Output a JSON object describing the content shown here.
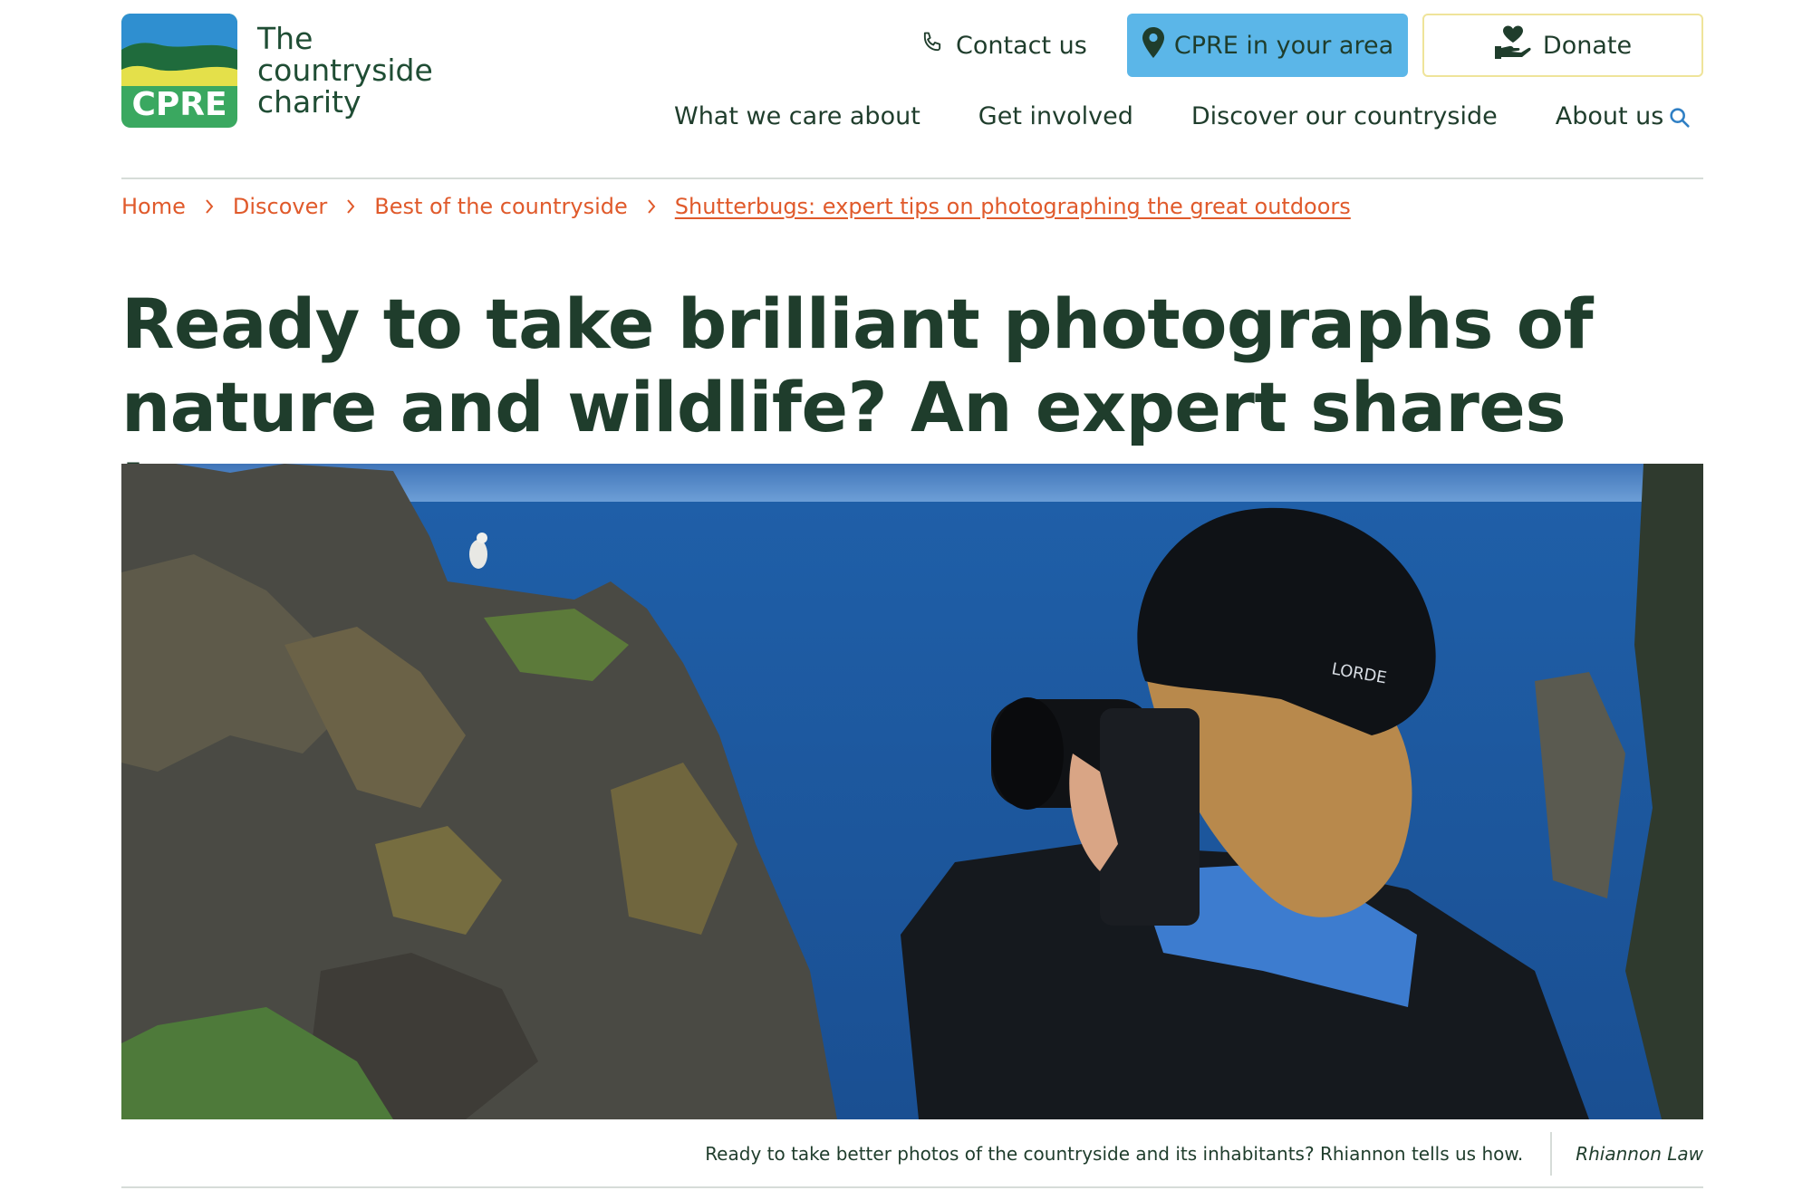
{
  "brand": {
    "badge_text": "CPRE",
    "line1": "The",
    "line2": "countryside",
    "line3": "charity"
  },
  "utility": {
    "contact_label": "Contact us",
    "area_label": "CPRE in your area",
    "donate_label": "Donate"
  },
  "nav": {
    "items": [
      {
        "label": "What we care about"
      },
      {
        "label": "Get involved"
      },
      {
        "label": "Discover our countryside"
      },
      {
        "label": "About us"
      }
    ]
  },
  "breadcrumb": {
    "items": [
      {
        "label": "Home"
      },
      {
        "label": "Discover"
      },
      {
        "label": "Best of the countryside"
      }
    ],
    "current": "Shutterbugs: expert tips on photographing the great outdoors"
  },
  "article": {
    "title": "Ready to take brilliant photographs of nature and wildlife? An expert shares how",
    "hero_cap_text": "LORDE",
    "caption": "Ready to take better photos of the countryside and its inhabitants? Rhiannon tells us how.",
    "credit": "Rhiannon Law"
  },
  "colors": {
    "brand_green": "#1f4d34",
    "accent_blue": "#5bb6e8",
    "breadcrumb_orange": "#e05a2b",
    "donate_border": "#efe49a"
  }
}
